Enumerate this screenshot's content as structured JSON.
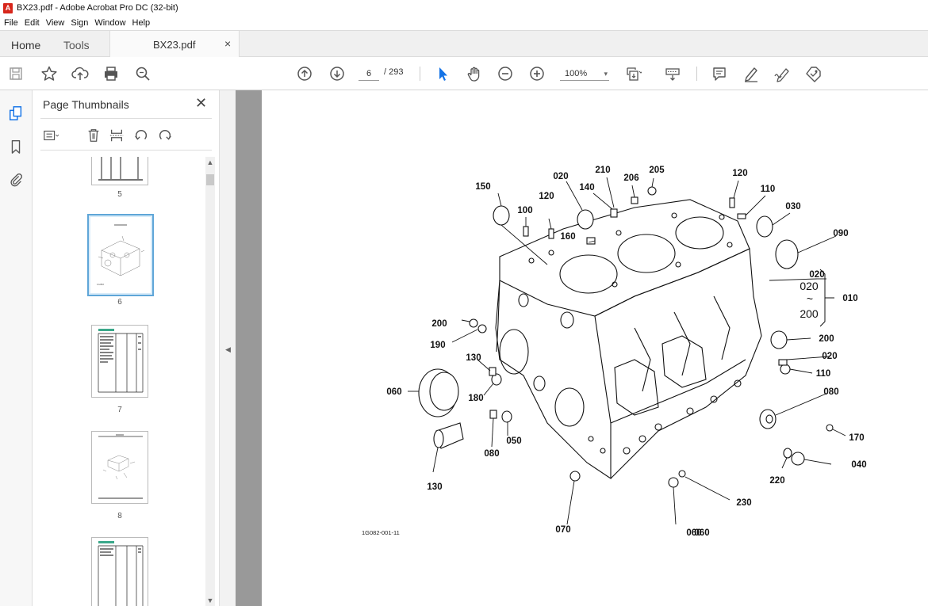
{
  "window": {
    "title": "BX23.pdf - Adobe Acrobat Pro DC (32-bit)"
  },
  "menu": [
    "File",
    "Edit",
    "View",
    "Sign",
    "Window",
    "Help"
  ],
  "tabs": {
    "home": "Home",
    "tools": "Tools",
    "document": "BX23.pdf",
    "close": "×"
  },
  "toolbar": {
    "current_page": "6",
    "page_count": "/ 293",
    "zoom": "100%",
    "zoom_caret": "▾"
  },
  "thumbnails_panel": {
    "title": "Page Thumbnails",
    "close": "✕",
    "pages": [
      {
        "label": "5"
      },
      {
        "label": "6",
        "selected": true
      },
      {
        "label": "7"
      },
      {
        "label": "8"
      }
    ]
  },
  "diagram": {
    "figure_id": "1G082-001-11",
    "callouts": [
      "210",
      "205",
      "020",
      "140",
      "206",
      "120",
      "150",
      "120",
      "110",
      "100",
      "030",
      "160",
      "090",
      "020",
      "010",
      "200",
      "190",
      "200",
      "020",
      "110",
      "130",
      "060",
      "180",
      "080",
      "050",
      "080",
      "130",
      "170",
      "040",
      "220",
      "230",
      "070",
      "060",
      "060"
    ],
    "bracket_top": "020",
    "bracket_tilde": "~",
    "bracket_bottom": "200"
  }
}
